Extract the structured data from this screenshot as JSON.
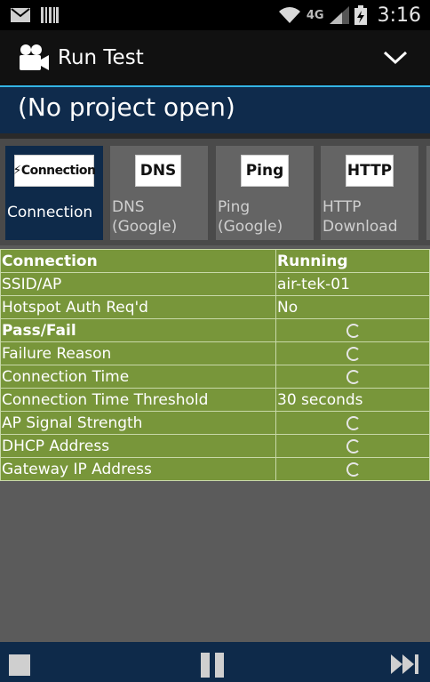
{
  "status_bar": {
    "time": "3:16",
    "network_label": "4G",
    "icons": [
      "gmail-icon",
      "barcode-icon",
      "wifi-icon",
      "cell-signal-icon",
      "battery-icon"
    ]
  },
  "action_bar": {
    "title": "Run Test",
    "icon": "video-camera-icon",
    "menu_icon": "chevron-down-icon"
  },
  "project": {
    "text": "(No project open)"
  },
  "tests": [
    {
      "badge": "⚡Connection",
      "label": "Connection",
      "active": true
    },
    {
      "badge": "DNS",
      "label": "DNS\n(Google)",
      "active": false
    },
    {
      "badge": "Ping",
      "label": "Ping\n(Google)",
      "active": false
    },
    {
      "badge": "HTTP",
      "label": "HTTP\nDownload",
      "active": false
    }
  ],
  "results": {
    "header": {
      "name": "Connection",
      "value": "Running"
    },
    "rows": [
      {
        "name": "SSID/AP",
        "value": "air-tek-01",
        "pending": false
      },
      {
        "name": "Hotspot Auth Req'd",
        "value": "No",
        "pending": false
      },
      {
        "name": "Pass/Fail",
        "value": "",
        "pending": true
      },
      {
        "name": "Failure Reason",
        "value": "",
        "pending": true
      },
      {
        "name": "Connection Time",
        "value": "",
        "pending": true
      },
      {
        "name": "Connection Time Threshold",
        "value": "30 seconds",
        "pending": false
      },
      {
        "name": "AP Signal Strength",
        "value": "",
        "pending": true
      },
      {
        "name": "DHCP Address",
        "value": "",
        "pending": true
      },
      {
        "name": "Gateway IP Address",
        "value": "",
        "pending": true
      }
    ]
  },
  "controls": {
    "icons": [
      "stop-icon",
      "pause-icon",
      "fast-forward-icon"
    ]
  },
  "colors": {
    "accent": "#33b5e5",
    "banner": "#0f2b4c",
    "table_green": "#78963a",
    "background": "#5b5b5b"
  }
}
